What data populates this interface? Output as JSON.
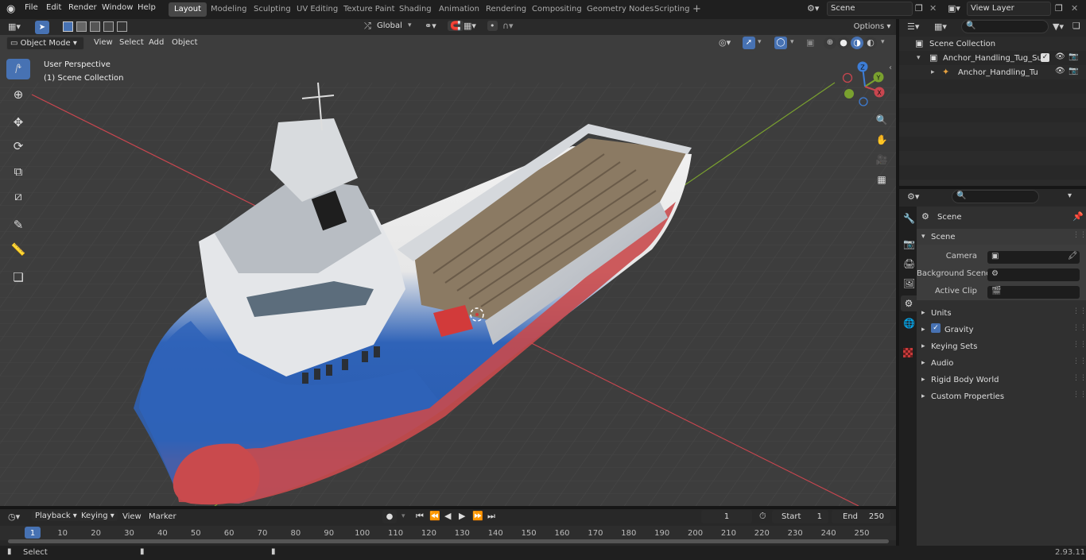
{
  "menus": [
    "File",
    "Edit",
    "Render",
    "Window",
    "Help"
  ],
  "workspaces": [
    "Layout",
    "Modeling",
    "Sculpting",
    "UV Editing",
    "Texture Paint",
    "Shading",
    "Animation",
    "Rendering",
    "Compositing",
    "Geometry Nodes",
    "Scripting"
  ],
  "active_workspace": "Layout",
  "scene_field": "Scene",
  "view_layer_field": "View Layer",
  "viewport": {
    "mode": "Object Mode",
    "menus": [
      "View",
      "Select",
      "Add",
      "Object"
    ],
    "transform_orientation": "Global",
    "options_label": "Options",
    "overlay_title": "User Perspective",
    "overlay_subtitle": "(1) Scene Collection",
    "gizmo_labels": {
      "x": "X",
      "y": "Y",
      "z": "Z"
    }
  },
  "outliner": {
    "search_placeholder": "",
    "root": "Scene Collection",
    "collection": "Anchor_Handling_Tug_Supply",
    "object": "Anchor_Handling_Tug_Su"
  },
  "properties": {
    "context": "Scene",
    "section": "Scene",
    "fields": [
      {
        "label": "Camera",
        "value": ""
      },
      {
        "label": "Background Scene",
        "value": ""
      },
      {
        "label": "Active Clip",
        "value": ""
      }
    ],
    "panels": [
      "Units",
      "Gravity",
      "Keying Sets",
      "Audio",
      "Rigid Body World",
      "Custom Properties"
    ]
  },
  "timeline": {
    "menus": [
      "Playback",
      "Keying",
      "View",
      "Marker"
    ],
    "current_frame": "1",
    "start_label": "Start",
    "start_value": "1",
    "end_label": "End",
    "end_value": "250",
    "ticks": [
      "1",
      "10",
      "20",
      "30",
      "40",
      "50",
      "60",
      "70",
      "80",
      "90",
      "100",
      "110",
      "120",
      "130",
      "140",
      "150",
      "160",
      "170",
      "180",
      "190",
      "200",
      "210",
      "220",
      "230",
      "240",
      "250"
    ]
  },
  "status": {
    "left": "Select",
    "version": "2.93.11"
  },
  "colors": {
    "accent": "#4772b3",
    "x_axis": "#c8464f",
    "y_axis": "#7aa12f",
    "z_axis": "#3d7dd6",
    "hull_blue": "#2f63b8",
    "hull_red": "#c94a4d"
  }
}
